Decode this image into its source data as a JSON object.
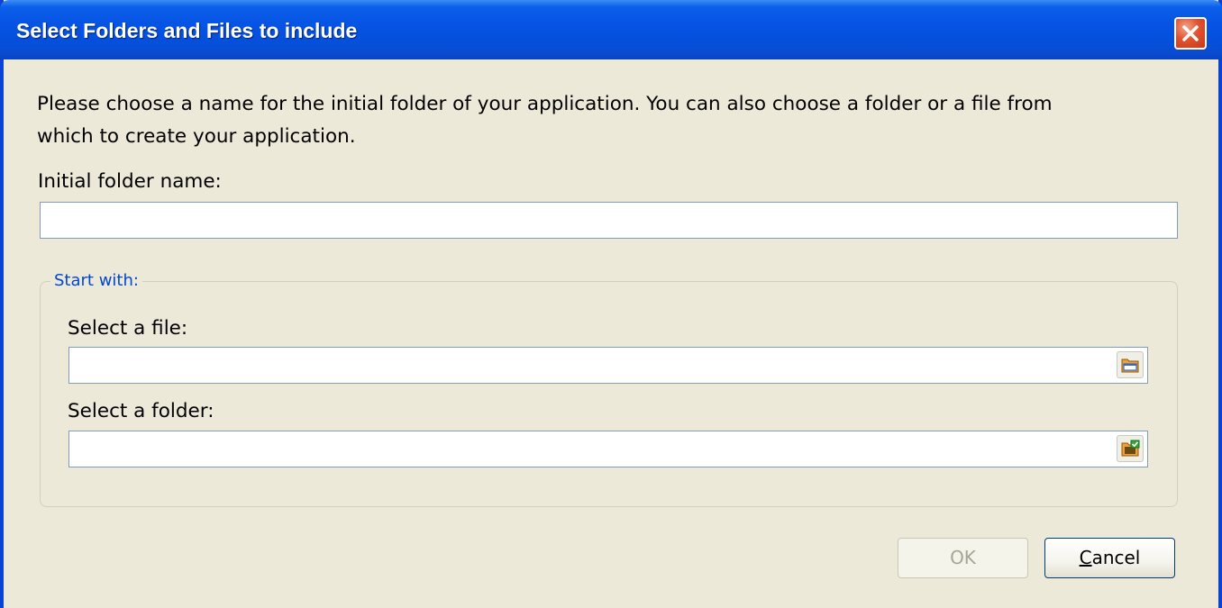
{
  "window": {
    "title": "Select Folders and Files to include"
  },
  "description": {
    "line1": "Please choose a name for the initial folder of your application. You can also choose a folder or a file from",
    "line2": "which to create your application."
  },
  "initial_folder": {
    "label": "Initial folder name:",
    "value": ""
  },
  "start_with": {
    "legend": "Start with:",
    "file": {
      "label": "Select a file:",
      "value": "",
      "icon": "open-file-icon"
    },
    "folder": {
      "label": "Select a folder:",
      "value": "",
      "icon": "browse-folder-icon"
    }
  },
  "buttons": {
    "ok_label": "OK",
    "cancel_accel": "C",
    "cancel_rest": "ancel"
  },
  "colors": {
    "titlebar": "#0653e4",
    "legend": "#0046d5",
    "dialog_bg": "#ece9d8"
  }
}
